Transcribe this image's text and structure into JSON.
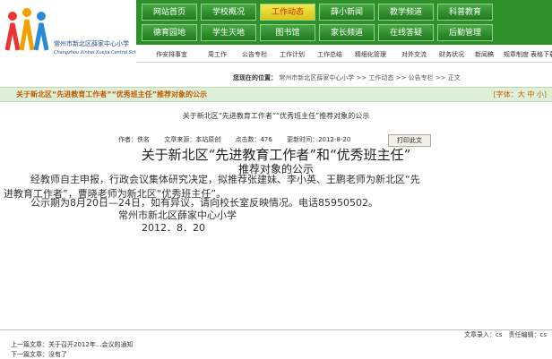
{
  "logo": {
    "name_cn": "常州市新北区薛家中心小学",
    "name_en": "Changzhou Xinbei Xuejia Central School"
  },
  "nav": [
    {
      "label": "网站首页"
    },
    {
      "label": "学校概况"
    },
    {
      "label": "工作动态"
    },
    {
      "label": "薛小新闻"
    },
    {
      "label": "教学频道"
    },
    {
      "label": "科普教育"
    },
    {
      "label": "德育园地"
    },
    {
      "label": "学生天地"
    },
    {
      "label": "图书馆"
    },
    {
      "label": "家长频道"
    },
    {
      "label": "在线答疑"
    },
    {
      "label": "后勤管理"
    }
  ],
  "subnav": [
    {
      "label": "作安排事宜"
    },
    {
      "label": "周工作"
    },
    {
      "label": "公告专栏"
    },
    {
      "label": "工作计划"
    },
    {
      "label": "工作总结"
    },
    {
      "label": "精细化管理"
    },
    {
      "label": "对外交流"
    },
    {
      "label": "财务状况"
    },
    {
      "label": "新闻稿"
    },
    {
      "label": "规章制度"
    },
    {
      "label": "表格下载"
    }
  ],
  "breadcrumb": {
    "prefix": "您现在的位置：",
    "path": "常州市新北区薛家中心小学 >> 工作动态 >> 公告专栏 >> 正文"
  },
  "title_bar": {
    "title": "关于新北区“先进教育工作者”“优秀班主任”推荐对象的公示",
    "right": "[字体：大 中 小]"
  },
  "page_heading": "关于新北区“先进教育工作者”“优秀班主任”推荐对象的公示",
  "meta": {
    "author": "作者：佚名",
    "source": "文章来源：本站原创",
    "hits": "点击数：476",
    "date": "更新时间：2012-8-20",
    "print_label": "打印此文"
  },
  "article": {
    "title": "关于新北区“先进教育工作者”和“优秀班主任”",
    "subtitle": "推荐对象的公示",
    "para1_line1": "经教师自主申报，行政会议集体研究决定，拟推荐张建妹、李小英、王鹏老师为新北区“先",
    "para1_line2": "进教育工作者”，曹晓老师为新北区“优秀班主任”。",
    "para2": "公示期为8月20日—24日，如有异议，请向校长室反映情况。电话85950502。",
    "signature": "常州市新北区薛家中心小学",
    "date": "2012．8．20"
  },
  "footer": {
    "right": "文章录入：cs　责任编辑：cs",
    "prev_label": "上一篇文章：",
    "prev_title": "关于召开2012年...会议的通知",
    "next_label": "下一篇文章：",
    "next_title": "没有了"
  },
  "colors": {
    "nav_green": "#2f8f2a",
    "active_tab": "#f3e84a",
    "title_orange": "#c05a00"
  }
}
